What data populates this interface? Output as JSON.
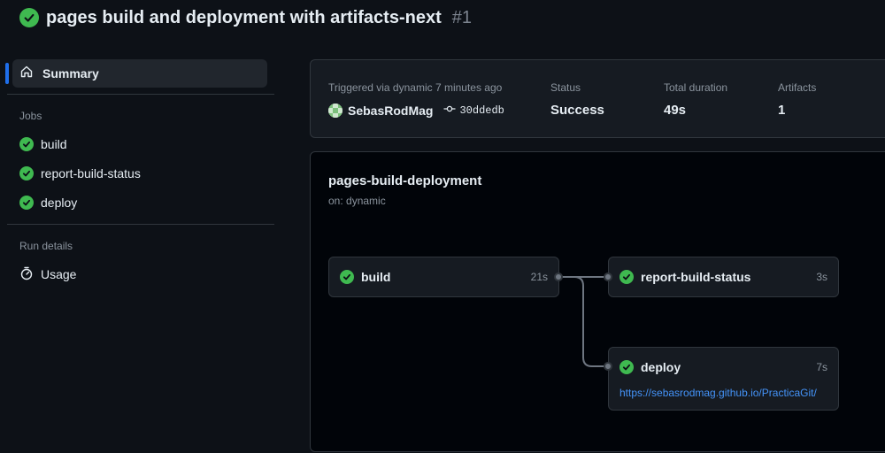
{
  "header": {
    "title": "pages build and deployment with artifacts-next",
    "run_number": "#1"
  },
  "sidebar": {
    "summary_label": "Summary",
    "jobs_section": "Jobs",
    "jobs": [
      "build",
      "report-build-status",
      "deploy"
    ],
    "run_details_section": "Run details",
    "usage_label": "Usage"
  },
  "info": {
    "trigger_label": "Triggered via dynamic 7 minutes ago",
    "actor": "SebasRodMag",
    "commit": "30ddedb",
    "status_label": "Status",
    "status_value": "Success",
    "duration_label": "Total duration",
    "duration_value": "49s",
    "artifacts_label": "Artifacts",
    "artifacts_value": "1"
  },
  "workflow": {
    "name": "pages-build-deployment",
    "trigger": "on: dynamic",
    "jobs": {
      "build": {
        "name": "build",
        "duration": "21s"
      },
      "report": {
        "name": "report-build-status",
        "duration": "3s"
      },
      "deploy": {
        "name": "deploy",
        "duration": "7s",
        "url": "https://sebasrodmag.github.io/PracticaGit/"
      }
    }
  },
  "colors": {
    "success": "#3fb950",
    "accent": "#1f6feb",
    "link": "#4493f8",
    "background": "#0d1117"
  },
  "icons": [
    "success-check-icon",
    "home-icon",
    "stopwatch-icon",
    "commit-icon"
  ]
}
